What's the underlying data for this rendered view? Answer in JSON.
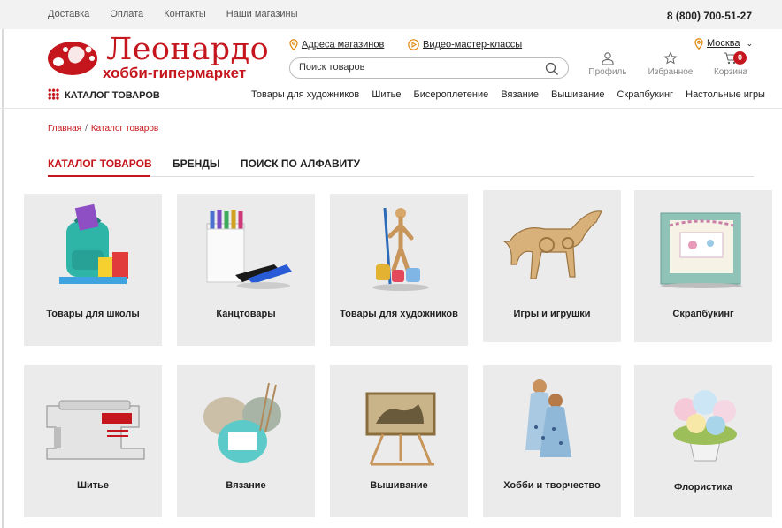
{
  "topbar": {
    "links": [
      "Доставка",
      "Оплата",
      "Контакты",
      "Наши магазины"
    ],
    "phone": "8 (800) 700-51-27"
  },
  "logo": {
    "name": "Леонардо",
    "tagline": "хобби-гипермаркет"
  },
  "header": {
    "stores_link": "Адреса магазинов",
    "video_link": "Видео-мастер-классы",
    "search_placeholder": "Поиск товаров",
    "city": "Москва",
    "profile": "Профиль",
    "favorites": "Избранное",
    "cart": "Корзина",
    "cart_count": "0"
  },
  "menu": {
    "catalog_label": "КАТАЛОГ ТОВАРОВ",
    "categories": [
      "Товары для художников",
      "Шитье",
      "Бисероплетение",
      "Вязание",
      "Вышивание",
      "Скрапбукинг",
      "Настольные игры"
    ]
  },
  "breadcrumb": [
    "Главная",
    "Каталог товаров"
  ],
  "tabs": [
    "КАТАЛОГ ТОВАРОВ",
    "БРЕНДЫ",
    "ПОИСК ПО АЛФАВИТУ"
  ],
  "cards": [
    {
      "label": "Товары для школы",
      "icon": "school-backpack-icon"
    },
    {
      "label": "Канцтовары",
      "icon": "markers-stapler-icon"
    },
    {
      "label": "Товары для художников",
      "icon": "artist-mannequin-icon"
    },
    {
      "label": "Игры и игрушки",
      "icon": "wooden-horse-icon"
    },
    {
      "label": "Скрапбукинг",
      "icon": "scrapbook-card-icon"
    },
    {
      "label": "Шитье",
      "icon": "sewing-machine-icon"
    },
    {
      "label": "Вязание",
      "icon": "yarn-balls-icon"
    },
    {
      "label": "Вышивание",
      "icon": "embroidery-frame-icon"
    },
    {
      "label": "Хобби и творчество",
      "icon": "handmade-dolls-icon"
    },
    {
      "label": "Флористика",
      "icon": "flower-bouquet-icon"
    }
  ],
  "colors": {
    "accent": "#c4161c",
    "card_bg": "#ebebeb"
  }
}
